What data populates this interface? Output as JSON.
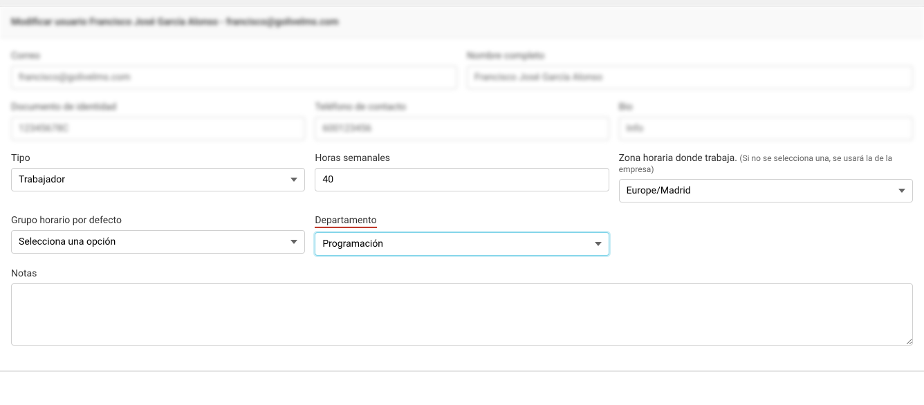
{
  "header": {
    "title": "Modificar usuario Francisco José García Alonso - francisco@golivelms.com"
  },
  "fields": {
    "email": {
      "label": "Correo",
      "value": "francisco@golivelms.com"
    },
    "fullname": {
      "label": "Nombre completo",
      "value": "Francisco José García Alonso"
    },
    "identity_doc": {
      "label": "Documento de identidad",
      "value": "12345678C"
    },
    "phone": {
      "label": "Teléfono de contacto",
      "value": "600123456"
    },
    "bio": {
      "label": "Bio",
      "value": "Info"
    },
    "type": {
      "label": "Tipo",
      "value": "Trabajador"
    },
    "weekly_hours": {
      "label": "Horas semanales",
      "value": "40"
    },
    "timezone": {
      "label": "Zona horaria donde trabaja.",
      "note": "(Si no se selecciona una, se usará la de la empresa)",
      "value": "Europe/Madrid"
    },
    "schedule_group": {
      "label": "Grupo horario por defecto",
      "value": "Selecciona una opción"
    },
    "department": {
      "label": "Departamento",
      "value": "Programación"
    },
    "notes": {
      "label": "Notas",
      "value": ""
    }
  }
}
